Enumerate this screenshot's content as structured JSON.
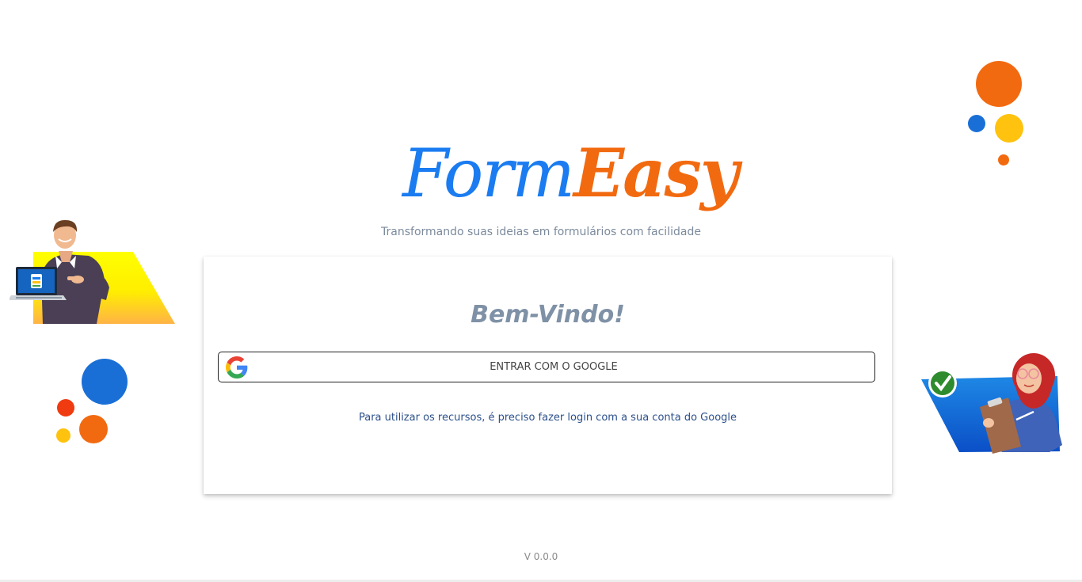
{
  "brand": {
    "logo_part1": "Form",
    "logo_part2": "Easy",
    "tagline": "Transformando suas ideias em formulários com facilidade",
    "colors": {
      "blue": "#1a7cf0",
      "orange": "#f26a10",
      "yellow": "#ffc20e"
    }
  },
  "login_card": {
    "title": "Bem-Vindo!",
    "google_button_label": "ENTRAR COM O GOOGLE",
    "google_icon": "google-icon",
    "note": "Para utilizar os recursos, é preciso fazer login com a sua conta do Google"
  },
  "footer": {
    "version": "V 0.0.0"
  }
}
